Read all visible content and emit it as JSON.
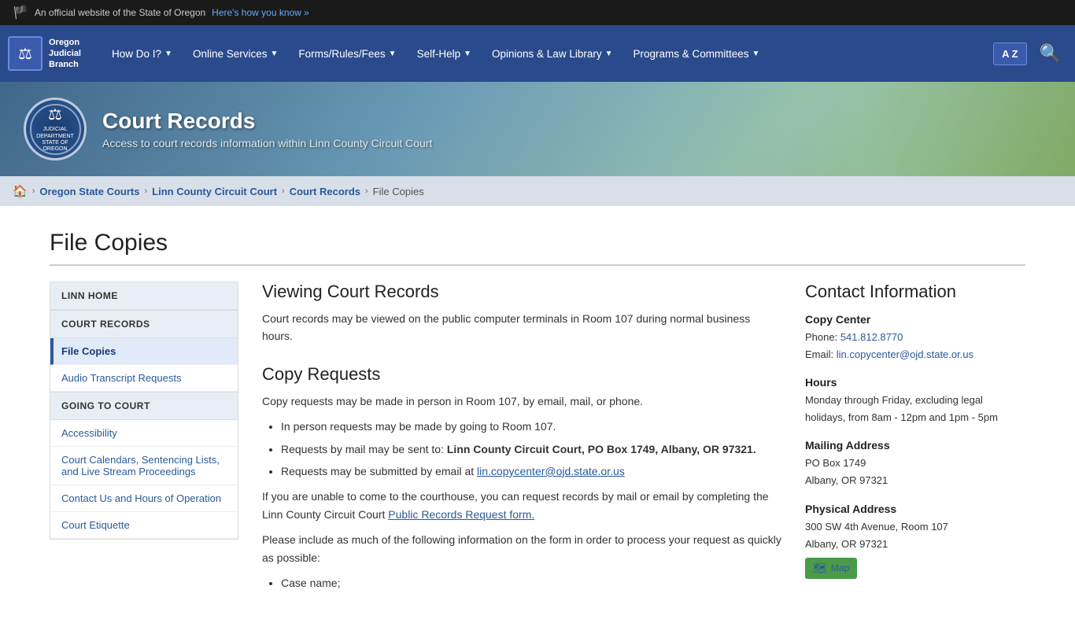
{
  "topBanner": {
    "flag": "🏴",
    "text": "An official website of the State of Oregon",
    "linkText": "Here's how you know »"
  },
  "nav": {
    "logoLine1": "Oregon",
    "logoLine2": "Judicial",
    "logoLine3": "Branch",
    "items": [
      {
        "label": "How Do I?",
        "hasDropdown": true
      },
      {
        "label": "Online Services",
        "hasDropdown": true
      },
      {
        "label": "Forms/Rules/Fees",
        "hasDropdown": true
      },
      {
        "label": "Self-Help",
        "hasDropdown": true
      },
      {
        "label": "Opinions & Law Library",
        "hasDropdown": true
      },
      {
        "label": "Programs & Committees",
        "hasDropdown": true
      }
    ],
    "translateLabel": "A Z",
    "searchTitle": "Search"
  },
  "hero": {
    "title": "Court Records",
    "subtitle": "Access to court records information within Linn County Circuit Court",
    "sealText": "JUDICIAL DEPARTMENT STATE OF OREGON"
  },
  "breadcrumb": {
    "home": "🏠",
    "items": [
      {
        "label": "Oregon State Courts",
        "href": "#"
      },
      {
        "label": "Linn County Circuit Court",
        "href": "#"
      },
      {
        "label": "Court Records",
        "href": "#"
      },
      {
        "label": "File Copies",
        "current": true
      }
    ]
  },
  "pageTitle": "File Copies",
  "sidebar": {
    "sections": [
      {
        "heading": "LINN HOME",
        "items": []
      },
      {
        "heading": "COURT RECORDS",
        "items": [
          {
            "label": "File Copies",
            "active": true
          },
          {
            "label": "Audio Transcript Requests",
            "active": false
          }
        ]
      },
      {
        "heading": "GOING TO COURT",
        "items": [
          {
            "label": "Accessibility",
            "active": false
          },
          {
            "label": "Court Calendars, Sentencing Lists, and Live Stream Proceedings",
            "active": false
          },
          {
            "label": "Contact Us and Hours of Operation",
            "active": false
          },
          {
            "label": "Court Etiquette",
            "active": false
          }
        ]
      }
    ]
  },
  "mainContent": {
    "viewingTitle": "Viewing Court Records",
    "viewingText": "Court records may be viewed on the public computer terminals in Room 107 during normal business hours.",
    "copyTitle": "Copy Requests",
    "copyIntro": "Copy requests may be made in person in Room 107, by email, mail, or phone.",
    "copyBullets": [
      "In person requests may be made by going to Room 107.",
      "Requests by mail may be sent to: Linn County Circuit Court, PO Box 1749, Albany, OR 97321.",
      "Requests may be submitted by email at lin.copycenter@ojd.state.or.us"
    ],
    "mailBoldPart": "Linn County Circuit Court, PO Box 1749, Albany, OR 97321.",
    "unableText": "If you are unable to come to the courthouse, you can request records by mail or email by completing the Linn County Circuit Court",
    "publicRecordsLinkText": "Public Records Request form.",
    "includeText": "Please include as much of the following information on the form in order to process your request as quickly as possible:",
    "includeBullets": [
      "Case name;"
    ]
  },
  "contactInfo": {
    "title": "Contact Information",
    "blocks": [
      {
        "heading": "Copy Center",
        "lines": [
          {
            "text": "Phone: ",
            "link": "541.812.8770",
            "href": "tel:5418128770"
          },
          {
            "text": "Email: ",
            "link": "lin.copycenter@ojd.state.or.us",
            "href": "mailto:lin.copycenter@ojd.state.or.us"
          }
        ]
      },
      {
        "heading": "Hours",
        "text": "Monday through Friday, excluding legal holidays, from 8am - 12pm and 1pm - 5pm"
      },
      {
        "heading": "Mailing Address",
        "text": "PO Box 1749\nAlbany, OR 97321"
      },
      {
        "heading": "Physical Address",
        "text": "300 SW 4th Avenue, Room 107\nAlbany, OR 97321"
      }
    ],
    "mapLabel": "Map"
  }
}
